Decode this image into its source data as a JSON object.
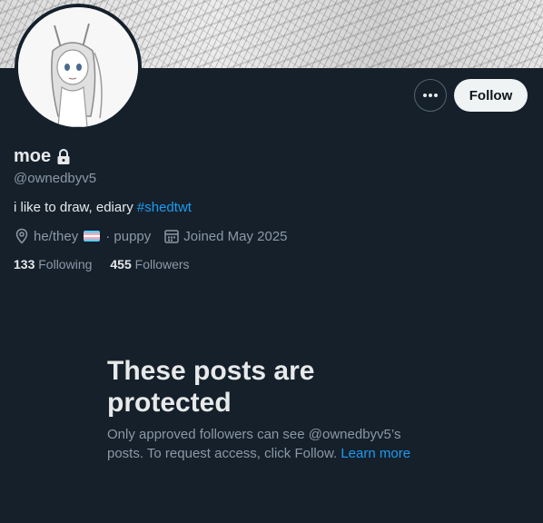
{
  "profile": {
    "display_name": "moe",
    "handle": "@ownedbyv5",
    "bio_text": "i like to draw, ediary ",
    "bio_hashtag": "#shedtwt",
    "location_part1": "he/they",
    "location_part2": "· puppy",
    "joined": "Joined May 2025",
    "following_count": "133",
    "following_label": "Following",
    "followers_count": "455",
    "followers_label": "Followers"
  },
  "actions": {
    "follow_label": "Follow"
  },
  "protected": {
    "title": "These posts are protected",
    "text": "Only approved followers can see @ownedbyv5’s posts. To request access, click Follow. ",
    "learn_more": "Learn more"
  },
  "icons": [
    "lock-icon",
    "location-icon",
    "calendar-icon",
    "more-icon"
  ],
  "colors": {
    "background": "#15202b",
    "accent": "#1d9bf0",
    "muted": "#8b98a5"
  }
}
